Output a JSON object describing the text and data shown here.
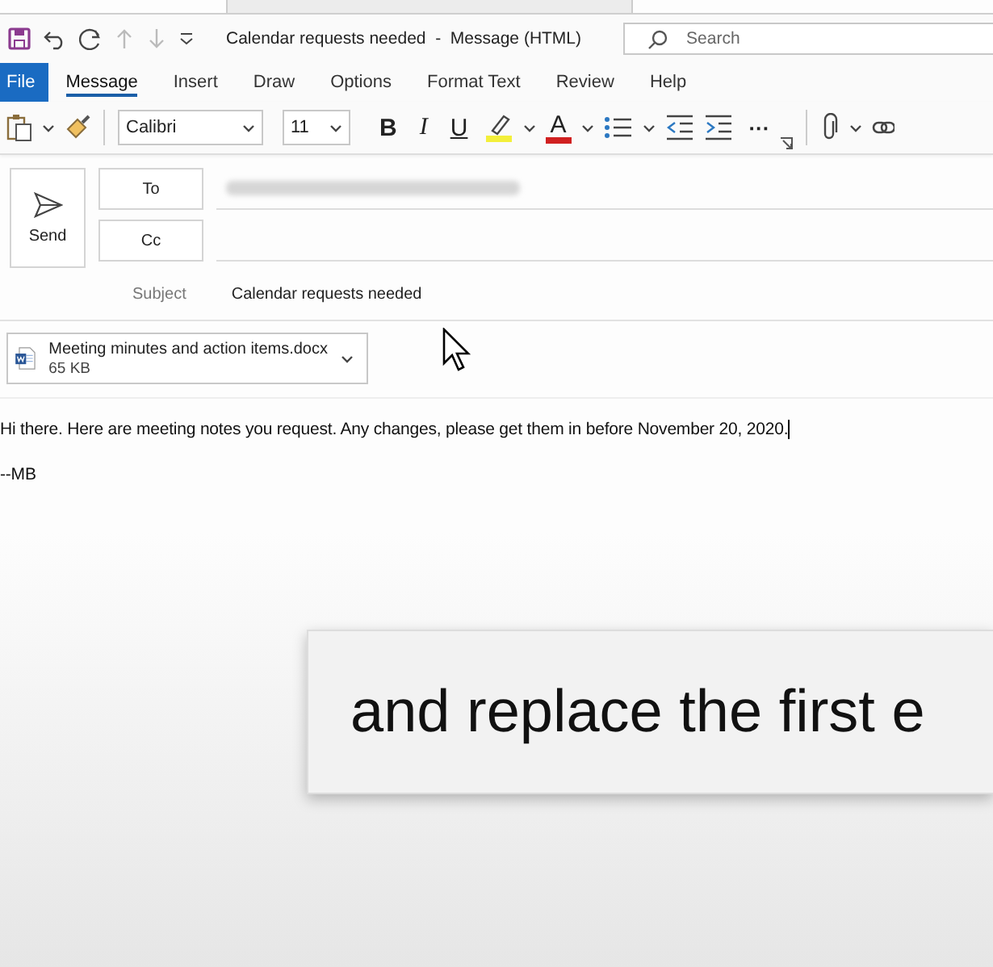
{
  "window": {
    "title": "Calendar requests needed  -  Message (HTML)"
  },
  "search": {
    "placeholder": "Search"
  },
  "tabs": [
    {
      "label": "File",
      "kind": "file",
      "selected": false
    },
    {
      "label": "Message",
      "kind": "tab",
      "selected": true
    },
    {
      "label": "Insert",
      "kind": "tab",
      "selected": false
    },
    {
      "label": "Draw",
      "kind": "tab",
      "selected": false
    },
    {
      "label": "Options",
      "kind": "tab",
      "selected": false
    },
    {
      "label": "Format Text",
      "kind": "tab",
      "selected": false
    },
    {
      "label": "Review",
      "kind": "tab",
      "selected": false
    },
    {
      "label": "Help",
      "kind": "tab",
      "selected": false
    }
  ],
  "toolbar": {
    "font": "Calibri",
    "size": "11",
    "bold": "B",
    "italic": "I",
    "underline": "U",
    "font_color": "A",
    "more": "···"
  },
  "header": {
    "send": "Send",
    "to": "To",
    "cc": "Cc",
    "subject_label": "Subject",
    "subject": "Calendar requests needed"
  },
  "attachment": {
    "name": "Meeting minutes and action items.docx",
    "size": "65 KB"
  },
  "body": {
    "lines": [
      "Hi there. Here are meeting notes you request. Any changes, please get them in before November 20, 2020.",
      "--MB"
    ]
  },
  "caption": {
    "text": "and replace the first e"
  }
}
